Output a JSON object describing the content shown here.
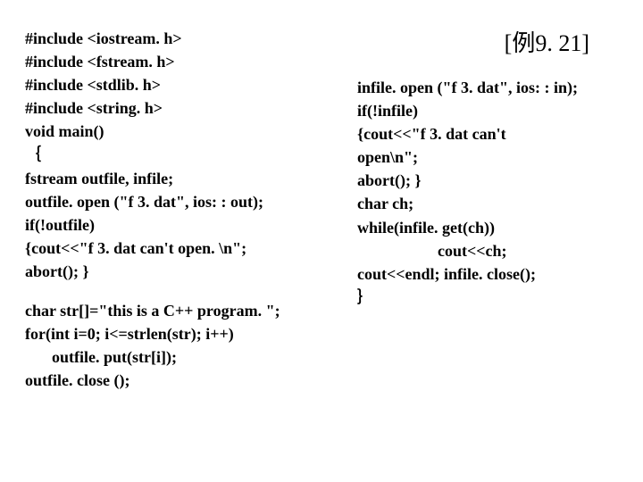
{
  "title": "[例9. 21]",
  "left": {
    "l1": "#include <iostream. h>",
    "l2": "#include <fstream. h>",
    "l3": "#include <stdlib. h>",
    "l4": "#include <string. h>",
    "l5": "void main()",
    "l6": "｛",
    "l7": "fstream outfile, infile;",
    "l8": "outfile. open (\"f 3. dat\", ios: : out);",
    "l9": "if(!outfile)",
    "l10": "{cout<<\"f 3. dat can't open. \\n\";",
    "l11": "abort(); }",
    "l12": "char str[]=\"this is a C++ program. \";",
    "l13": "for(int i=0; i<=strlen(str); i++)",
    "l14": "outfile. put(str[i]);",
    "l15": "outfile. close ();"
  },
  "right": {
    "r1": "infile. open (\"f 3. dat\", ios: : in);",
    "r2": "if(!infile)",
    "r3": "{cout<<\"f 3. dat can't",
    "r3b": "open\\n\";",
    "r4": "abort(); }",
    "r5": "char ch;",
    "r6": "while(infile. get(ch))",
    "r7": "cout<<ch;",
    "r8": "cout<<endl; infile. close();",
    "r9": "｝"
  }
}
